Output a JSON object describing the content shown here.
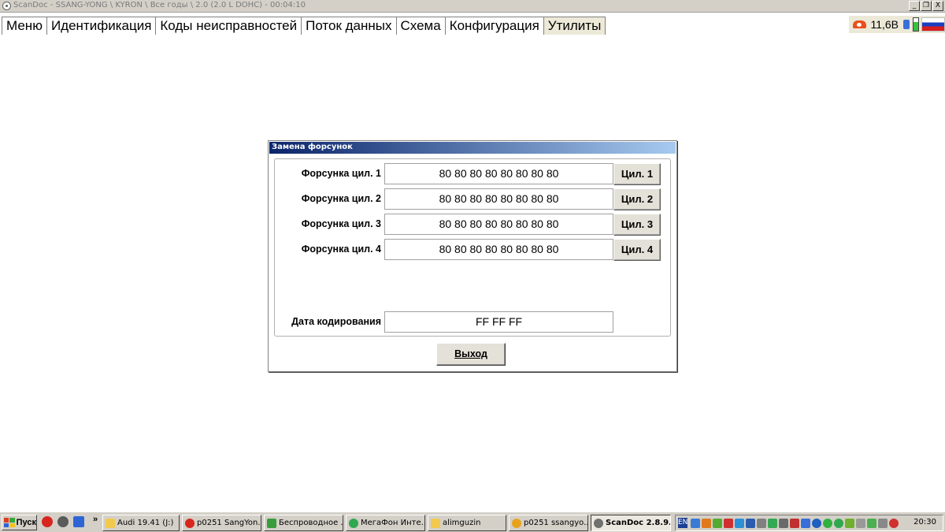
{
  "window": {
    "title": "ScanDoc - SSANG-YONG \\ KYRON \\ Все годы \\ 2.0 (2.0 L DOHC) - 00:04:10",
    "controls": [
      "_",
      "#",
      "X"
    ]
  },
  "tabs": [
    {
      "label": "Меню",
      "active": false
    },
    {
      "label": "Идентификация",
      "active": false
    },
    {
      "label": "Коды неисправностей",
      "active": false
    },
    {
      "label": "Поток данных",
      "active": false
    },
    {
      "label": "Схема",
      "active": false
    },
    {
      "label": "Конфигурация",
      "active": false
    },
    {
      "label": "Утилиты",
      "active": true
    }
  ],
  "status": {
    "voltage": "11,6В"
  },
  "dialog": {
    "title": "Замена форсунок",
    "injectors": [
      {
        "label": "Форсунка цил. 1",
        "value": "80 80 80 80 80 80 80 80",
        "button": "Цил. 1"
      },
      {
        "label": "Форсунка цил. 2",
        "value": "80 80 80 80 80 80 80 80",
        "button": "Цил. 2"
      },
      {
        "label": "Форсунка цил. 3",
        "value": "80 80 80 80 80 80 80 80",
        "button": "Цил. 3"
      },
      {
        "label": "Форсунка цил. 4",
        "value": "80 80 80 80 80 80 80 80",
        "button": "Цил. 4"
      }
    ],
    "coding_date": {
      "label": "Дата кодирования",
      "value": "FF FF FF"
    },
    "exit_label": "Выход"
  },
  "taskbar": {
    "start_label": "Пуск",
    "quick_launch_more": "»",
    "tasks": [
      {
        "label": "Audi 19.41 (J:)",
        "icon": "folder-icon",
        "color": "#f2c94c",
        "active": false
      },
      {
        "label": "p0251 SangYon...",
        "icon": "opera-icon",
        "color": "#d7261e",
        "active": false
      },
      {
        "label": "Беспроводное ...",
        "icon": "wireless-icon",
        "color": "#3a9c3a",
        "active": false
      },
      {
        "label": "МегаФон Инте...",
        "icon": "megafon-icon",
        "color": "#2fa84f",
        "active": false
      },
      {
        "label": "alimguzin",
        "icon": "folder-icon",
        "color": "#f2c94c",
        "active": false
      },
      {
        "label": "p0251 ssangyo...",
        "icon": "chrome-icon",
        "color": "#e8a21a",
        "active": false
      },
      {
        "label": "ScanDoc 2.8.9...",
        "icon": "scandoc-icon",
        "color": "#707070",
        "active": true
      }
    ],
    "tray": {
      "language": "EN",
      "clock": "20:30"
    }
  }
}
